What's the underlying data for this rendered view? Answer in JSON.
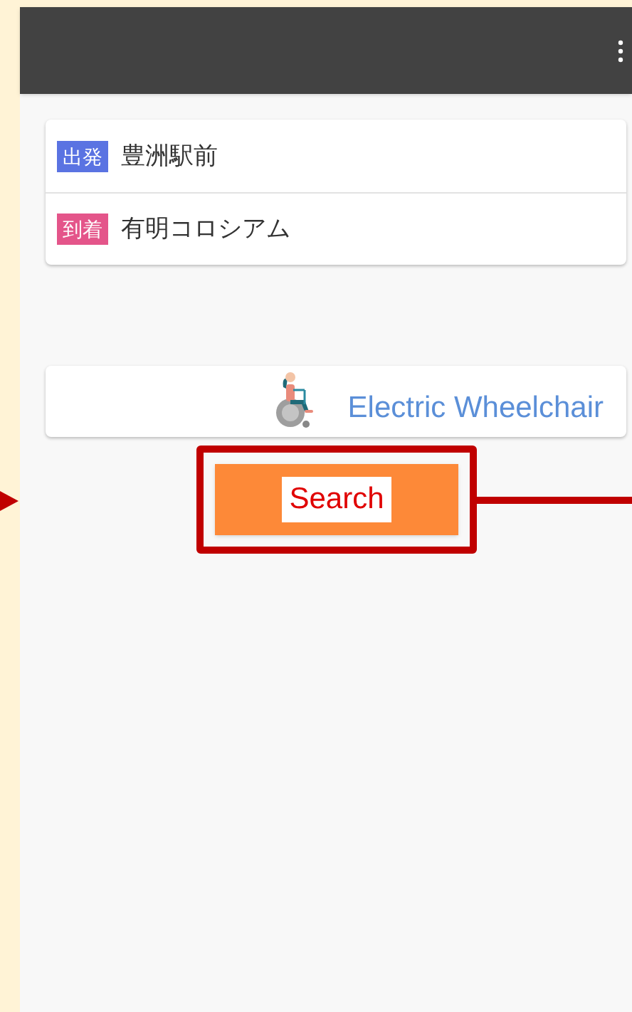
{
  "route": [
    {
      "badge": "出発",
      "place": "豊洲駅前",
      "color": "#5a73e2"
    },
    {
      "badge": "到着",
      "place": "有明コロシアム",
      "color": "#e4558a"
    }
  ],
  "mobility": {
    "label": "Electric Wheelchair"
  },
  "search_button": {
    "label": "Search"
  }
}
